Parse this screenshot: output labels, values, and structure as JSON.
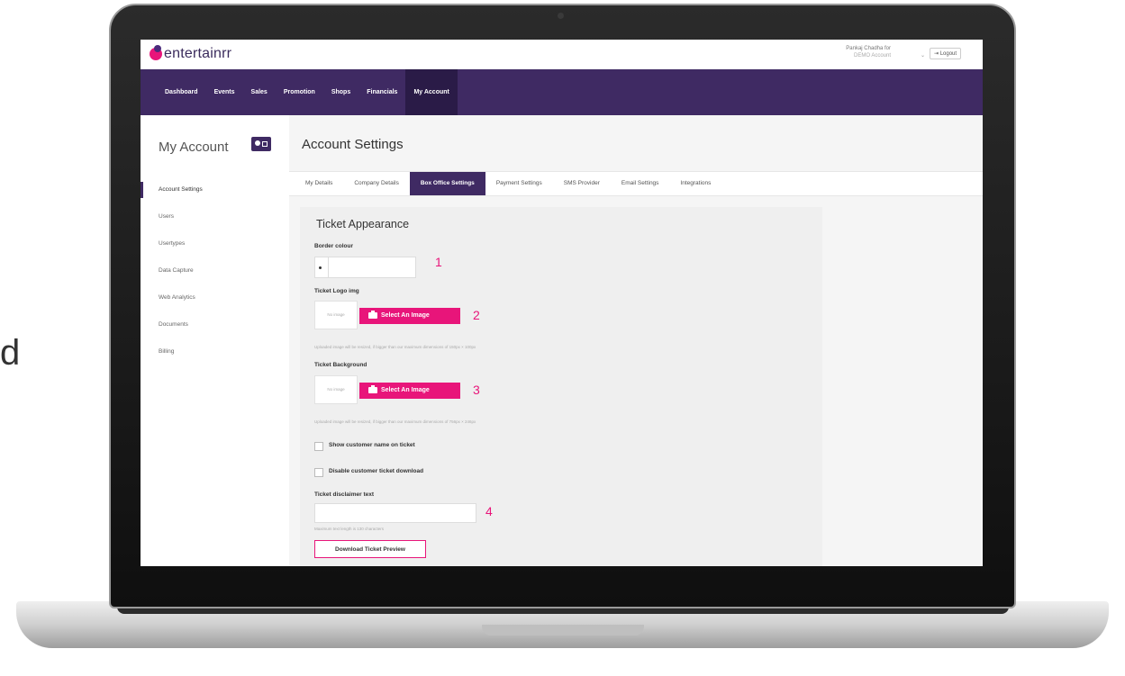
{
  "page_edge_text": "d",
  "app": {
    "logo_text": "entertainrr",
    "user_name": "Pankaj Chadha for",
    "user_sub": "DEMO Account",
    "logout_label": "Logout"
  },
  "nav": {
    "items": [
      {
        "label": "Dashboard"
      },
      {
        "label": "Events"
      },
      {
        "label": "Sales"
      },
      {
        "label": "Promotion"
      },
      {
        "label": "Shops"
      },
      {
        "label": "Financials"
      },
      {
        "label": "My Account",
        "active": true
      }
    ]
  },
  "sidebar": {
    "title": "My Account",
    "items": [
      {
        "label": "Account Settings",
        "active": true
      },
      {
        "label": "Users"
      },
      {
        "label": "Usertypes"
      },
      {
        "label": "Data Capture"
      },
      {
        "label": "Web Analytics"
      },
      {
        "label": "Documents"
      },
      {
        "label": "Billing"
      }
    ]
  },
  "main": {
    "title": "Account Settings",
    "tabs": [
      {
        "label": "My Details"
      },
      {
        "label": "Company Details"
      },
      {
        "label": "Box Office Settings",
        "active": true
      },
      {
        "label": "Payment Settings"
      },
      {
        "label": "SMS Provider"
      },
      {
        "label": "Email Settings"
      },
      {
        "label": "Integrations"
      }
    ]
  },
  "ticket": {
    "section_title": "Ticket Appearance",
    "border_colour_label": "Border colour",
    "logo_label": "Ticket Logo img",
    "no_image_text": "No image",
    "select_image_label": "Select An Image",
    "logo_hint": "Uploaded image will be resized, if bigger than our maximum dimensions of 150px × 100px",
    "background_label": "Ticket Background",
    "background_hint": "Uploaded image will be resized, if bigger than our maximum dimensions of 756px × 246px",
    "show_name_label": "Show customer name on ticket",
    "disable_download_label": "Disable customer ticket download",
    "disclaimer_label": "Ticket disclaimer text",
    "disclaimer_hint": "Maximum text length is 130 characters",
    "download_preview_label": "Download Ticket Preview"
  },
  "markers": [
    "1",
    "2",
    "3",
    "4"
  ],
  "colors": {
    "nav_bg": "#3f2a63",
    "accent_pink": "#e8157a"
  }
}
